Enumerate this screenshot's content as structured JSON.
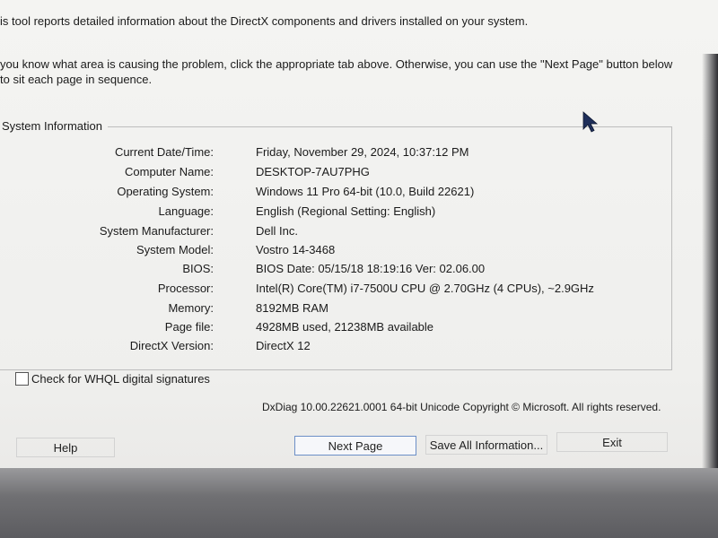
{
  "intro": {
    "line1": "is tool reports detailed information about the DirectX components and drivers installed on your system.",
    "line2": "you know what area is causing the problem, click the appropriate tab above.  Otherwise, you can use the \"Next Page\" button below to sit each page in sequence."
  },
  "system_info": {
    "title": "System Information",
    "rows": [
      {
        "label": "Current Date/Time:",
        "value": "Friday, November 29, 2024, 10:37:12 PM"
      },
      {
        "label": "Computer Name:",
        "value": "DESKTOP-7AU7PHG"
      },
      {
        "label": "Operating System:",
        "value": "Windows 11 Pro 64-bit (10.0, Build 22621)"
      },
      {
        "label": "Language:",
        "value": "English (Regional Setting: English)"
      },
      {
        "label": "System Manufacturer:",
        "value": "Dell Inc."
      },
      {
        "label": "System Model:",
        "value": "Vostro 14-3468"
      },
      {
        "label": "BIOS:",
        "value": "BIOS Date: 05/15/18 18:19:16 Ver: 02.06.00"
      },
      {
        "label": "Processor:",
        "value": "Intel(R) Core(TM) i7-7500U CPU @ 2.70GHz (4 CPUs), ~2.9GHz"
      },
      {
        "label": "Memory:",
        "value": "8192MB RAM"
      },
      {
        "label": "Page file:",
        "value": "4928MB used, 21238MB available"
      },
      {
        "label": "DirectX Version:",
        "value": "DirectX 12"
      }
    ]
  },
  "checkbox": {
    "label": "Check for WHQL digital signatures",
    "checked": false
  },
  "footer": {
    "version_text": "DxDiag 10.00.22621.0001 64-bit Unicode  Copyright © Microsoft. All rights reserved."
  },
  "buttons": {
    "help": "Help",
    "next_page": "Next Page",
    "save_all": "Save All Information...",
    "exit": "Exit"
  },
  "colors": {
    "focus_border": "#6c8fc7",
    "cursor": "#1f2f5a"
  },
  "icons": {
    "cursor": "mouse-pointer-icon"
  }
}
